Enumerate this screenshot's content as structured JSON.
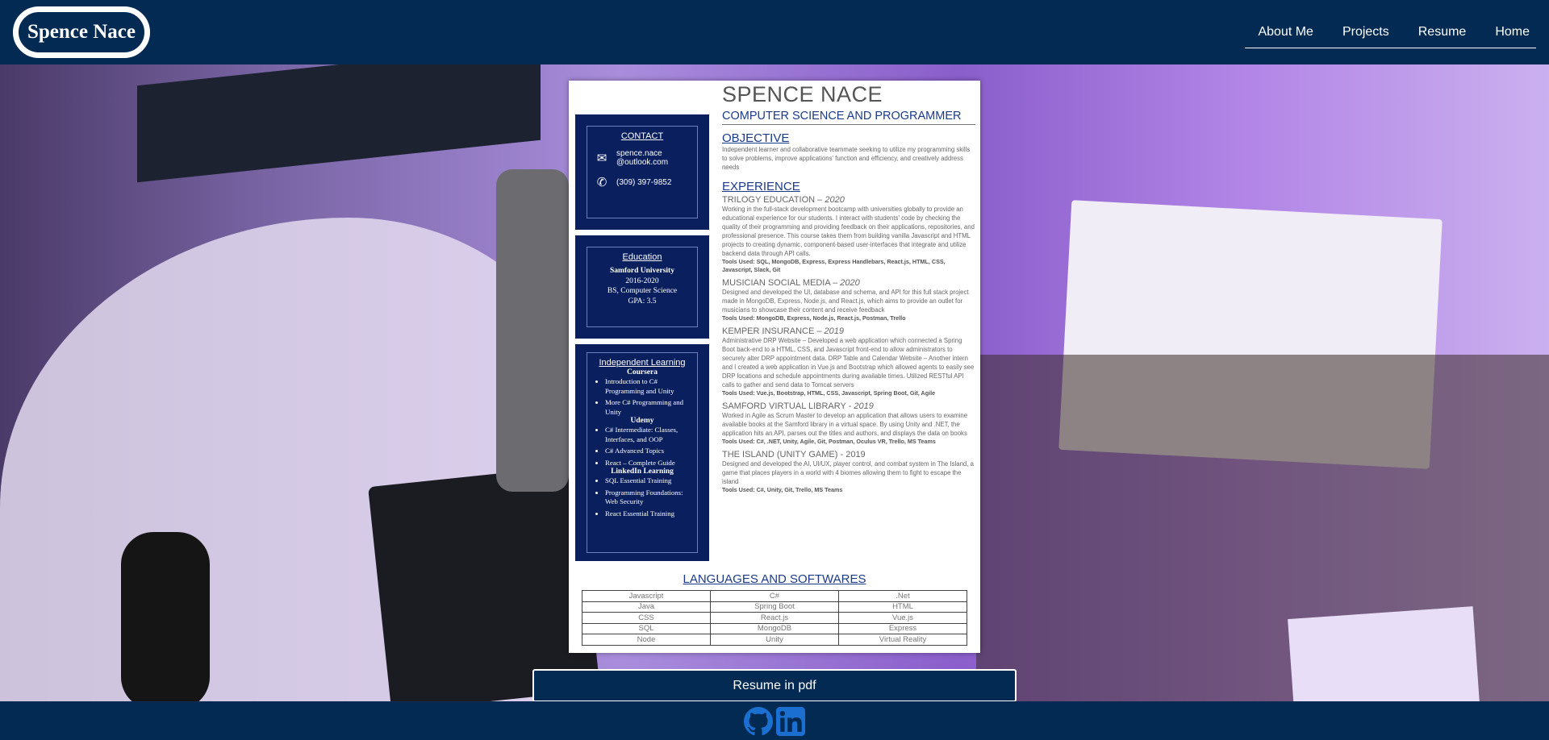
{
  "header": {
    "brand": "Spence Nace",
    "nav": [
      "About Me",
      "Projects",
      "Resume",
      "Home"
    ]
  },
  "resume": {
    "sidebar": {
      "contact": {
        "title": "CONTACT",
        "email_line1": "spence.nace",
        "email_line2": "@outlook.com",
        "phone": "(309) 397-9852"
      },
      "education": {
        "title": "Education",
        "school": "Samford University",
        "years": "2016-2020",
        "degree": "BS, Computer Science",
        "gpa": "GPA: 3.5"
      },
      "learning": {
        "title": "Independent Learning",
        "coursera": "Coursera",
        "coursera_items": [
          "Introduction to C# Programming and Unity",
          "More C# Programming and Unity"
        ],
        "udemy": "Udemy",
        "udemy_items": [
          "C# Intermediate: Classes, Interfaces, and OOP",
          "C# Advanced Topics",
          "React – Complete Guide"
        ],
        "linkedin": "LinkedIn Learning",
        "linkedin_items": [
          "SQL Essential Training",
          "Programming Foundations: Web Security",
          "React Essential Training"
        ]
      }
    },
    "name": "SPENCE NACE",
    "subtitle": "COMPUTER SCIENCE AND PROGRAMMER",
    "objective_title": "OBJECTIVE",
    "objective": "Independent learner and collaborative teammate seeking to utilize my programming skills to solve problems, improve applications' function and efficiency, and creatively address needs",
    "experience_title": "EXPERIENCE",
    "jobs": [
      {
        "title": "TRILOGY EDUCATION – ",
        "year": "2020",
        "desc": "Working in the full-stack development bootcamp with universities globally to provide an educational experience for our students. I interact with students' code by checking the quality of their programming and providing feedback on their applications, repositories, and professional presence. This course takes them from building vanilla Javascript and HTML projects to creating dynamic, component-based user-interfaces that integrate and utilize backend data through API calls.",
        "tools": "Tools Used: SQL, MongoDB, Express, Express Handlebars, React.js, HTML, CSS, Javascript, Slack, Git"
      },
      {
        "title": "MUSICIAN SOCIAL MEDIA – ",
        "year": "2020",
        "desc": "Designed and developed the UI, database and schema, and API for this full stack project made in MongoDB, Express, Node.js, and React.js, which aims to provide an outlet for musicians to showcase their content and receive feedback",
        "tools": "Tools Used: MongoDB, Express, Node.js, React.js, Postman, Trello"
      },
      {
        "title": "KEMPER INSURANCE – ",
        "year": "2019",
        "desc": "Administrative DRP Website – Developed a web application which connected a Spring Boot back-end to a HTML, CSS, and Javascript front-end to allow administrators to securely alter DRP appointment data. DRP Table and Calendar Website – Another intern and I created a web application in Vue.js and Bootstrap which allowed agents to easily see DRP locations and schedule appointments during available times. Utilized RESTful API calls to gather and send data to Tomcat servers",
        "tools": "Tools Used: Vue.js, Bootstrap, HTML, CSS, Javascript, Spring Boot, Git, Agile"
      },
      {
        "title": "SAMFORD VIRTUAL LIBRARY - ",
        "year": "2019",
        "desc": "Worked in Agile as Scrum Master to develop an application that allows users to examine available books at the Samford library in a virtual space. By using Unity and .NET, the application hits an API, parses out the titles and authors, and displays the data on books",
        "tools": "Tools Used: C#, .NET, Unity, Agile, Git, Postman, Oculus VR, Trello, MS Teams"
      },
      {
        "title": "THE ISLAND (UNITY GAME) - ",
        "year": "2019",
        "desc": "Designed and developed the AI, UI/UX, player control, and combat system in The Island, a game that places players in a world with 4 biomes allowing them to fight to escape the island",
        "tools": "Tools Used: C#, Unity, Git, Trello, MS Teams"
      }
    ],
    "languages_title": "LANGUAGES AND SOFTWARES",
    "languages": [
      [
        "Javascript",
        "C#",
        ".Net"
      ],
      [
        "Java",
        "Spring Boot",
        "HTML"
      ],
      [
        "CSS",
        "React.js",
        "Vue.js"
      ],
      [
        "SQL",
        "MongoDB",
        "Express"
      ],
      [
        "Node",
        "Unity",
        "Virtual Reality"
      ]
    ]
  },
  "pdf_button": "Resume in pdf",
  "footer": {
    "icons": [
      "github-icon",
      "linkedin-icon"
    ]
  },
  "colors": {
    "navy": "#022a52",
    "resume_navy": "#0a1f5e",
    "resume_blue": "#1b3a8a"
  }
}
